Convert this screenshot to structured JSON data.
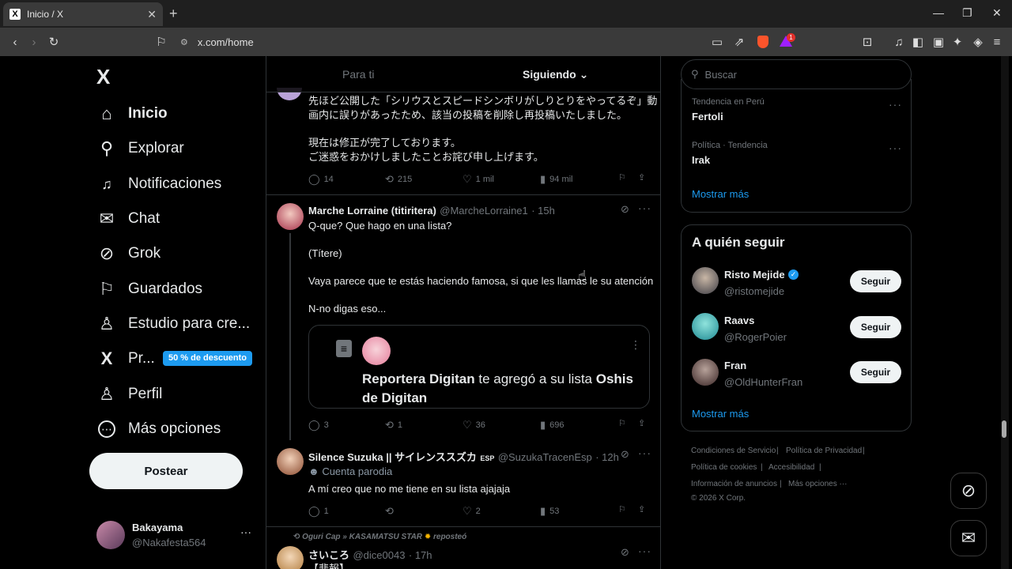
{
  "browser": {
    "tab_title": "Inicio / X",
    "tab_favicon": "X",
    "url": "x.com/home",
    "badge_count": "1"
  },
  "sidebar": {
    "logo": "X",
    "items": [
      {
        "label": "Inicio",
        "icon": "home-icon",
        "glyph": "⌂"
      },
      {
        "label": "Explorar",
        "icon": "search-icon",
        "glyph": "⚲"
      },
      {
        "label": "Notificaciones",
        "icon": "bell-icon",
        "glyph": "🔔"
      },
      {
        "label": "Chat",
        "icon": "mail-icon",
        "glyph": "✉"
      },
      {
        "label": "Grok",
        "icon": "grok-icon",
        "glyph": "⊘"
      },
      {
        "label": "Guardados",
        "icon": "bookmark-icon",
        "glyph": "⚑"
      },
      {
        "label": "Estudio para cre...",
        "icon": "studio-icon",
        "glyph": "♙"
      },
      {
        "label": "Pr...",
        "icon": "x-premium-icon",
        "glyph": "X"
      },
      {
        "label": "Perfil",
        "icon": "person-icon",
        "glyph": "♙"
      },
      {
        "label": "Más opciones",
        "icon": "more-circle-icon",
        "glyph": "⋯"
      }
    ],
    "promo_badge": "50 % de descuento",
    "post_button": "Postear",
    "account": {
      "name": "Bakayama",
      "handle": "@Nakafesta564"
    }
  },
  "timeline": {
    "tabs": [
      "Para ti",
      "Siguiendo"
    ],
    "active_tab": "Siguiendo",
    "posts": [
      {
        "text_lines": [
          "先ほど公開した「シリウスとスピードシンボリがしりとりをやってるぞ」動",
          "画内に誤りがあったため、該当の投稿を削除し再投稿いたしました。",
          "",
          "現在は修正が完了しております。",
          "ご迷惑をおかけしましたことお詫び申し上げます。"
        ],
        "replies": "14",
        "reposts": "215",
        "likes": "1 mil",
        "views": "94 mil"
      },
      {
        "name": "Marche Lorraine (titiritera)",
        "handle": "@MarcheLorraine1",
        "time": "· 15h",
        "text_lines": [
          "Q-que? Que hago en una lista?",
          "(Títere)",
          "Vaya parece que te estás haciendo famosa, si que les llamas le su atención",
          "N-no digas eso..."
        ],
        "quote_text_bold1": "Reportera Digitan",
        "quote_text_mid": " te agregó a su lista ",
        "quote_text_bold2": "Oshis de Digitan",
        "replies": "3",
        "reposts": "1",
        "likes": "36",
        "views": "696"
      },
      {
        "name": "Silence Suzuka || サイレンススズカ",
        "name_suffix": "ESP",
        "handle": "@SuzukaTracenEsp",
        "time": "· 12h",
        "label": "Cuenta parodia",
        "text": "A mí creo que no me tiene en su lista ajajaja",
        "replies": "1",
        "reposts": "",
        "likes": "2",
        "views": "53"
      },
      {
        "repost_by": "Oguri Cap » KASAMATSU STAR",
        "repost_suffix": "reposteó",
        "name": "さいころ",
        "handle": "@dice0043",
        "time": "· 17h",
        "text": "【悲報】"
      }
    ]
  },
  "right": {
    "search_placeholder": "Buscar",
    "trends": [
      {
        "context": "Tendencia en Perú",
        "topic": "Fertoli"
      },
      {
        "context": "Política · Tendencia",
        "topic": "Irak"
      }
    ],
    "show_more": "Mostrar más",
    "who_to_follow_title": "A quién seguir",
    "follow_suggestions": [
      {
        "name": "Risto Mejide",
        "handle": "@ristomejide",
        "verified": true,
        "button": "Seguir"
      },
      {
        "name": "Raavs",
        "handle": "@RogerPoier",
        "verified": false,
        "button": "Seguir"
      },
      {
        "name": "Fran",
        "handle": "@OldHunterFran",
        "verified": false,
        "button": "Seguir"
      }
    ],
    "show_more_2": "Mostrar más",
    "footer": [
      "Condiciones de Servicio",
      "|",
      "Política de Privacidad",
      "|",
      "Política de cookies",
      "|",
      "Accesibilidad",
      "|",
      "Información de anuncios",
      "|",
      "Más opciones ···",
      "© 2026 X Corp."
    ]
  },
  "colors": {
    "accent": "#1d9bf0",
    "background": "#000000",
    "border": "#2f3336",
    "muted": "#71767b"
  }
}
